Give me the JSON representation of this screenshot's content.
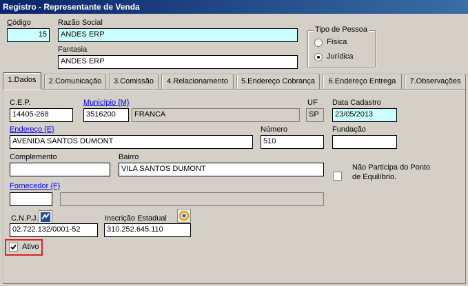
{
  "window": {
    "title": "Registro - Representante de Venda"
  },
  "header": {
    "codigo_label": "Código",
    "codigo_value": "15",
    "razao_label": "Razão Social",
    "razao_value": "ANDES ERP",
    "fantasia_label": "Fantasia",
    "fantasia_value": "ANDES ERP",
    "tipo_pessoa": {
      "title": "Tipo de Pessoa",
      "options": [
        {
          "label": "Física",
          "selected": false
        },
        {
          "label": "Jurídica",
          "selected": true
        }
      ]
    }
  },
  "tabs": [
    {
      "key": "1",
      "label": "1.Dados",
      "active": true
    },
    {
      "key": "2",
      "label": "2.Comunicação"
    },
    {
      "key": "3",
      "label": "3.Comissão"
    },
    {
      "key": "4",
      "label": "4.Relacionamento"
    },
    {
      "key": "5",
      "label": "5.Endereço Cobrança"
    },
    {
      "key": "6",
      "label": "6.Endereço Entrega"
    },
    {
      "key": "7",
      "label": "7.Observações"
    }
  ],
  "dados": {
    "cep_label": "C.E.P.",
    "cep_value": "14405-268",
    "municipio_label": "Município {M}",
    "municipio_code": "3516200",
    "municipio_name": "FRANCA",
    "uf_label": "UF",
    "uf_value": "SP",
    "data_cadastro_label": "Data Cadastro",
    "data_cadastro_value": "23/05/2013",
    "endereco_label": "Endereço {E}",
    "endereco_value": "AVENIDA SANTOS DUMONT",
    "numero_label": "Número",
    "numero_value": "510",
    "fundacao_label": "Fundação",
    "fundacao_value": "",
    "complemento_label": "Complemento",
    "complemento_value": "",
    "bairro_label": "Bairro",
    "bairro_value": "VILA SANTOS DUMONT",
    "ponto_equilibrio_label_1": "Não Participa do Ponto",
    "ponto_equilibrio_label_2": "de Equilíbrio.",
    "fornecedor_label": "Fornecedor {F}",
    "fornecedor_code": "",
    "fornecedor_name": "",
    "cnpj_label": "C.N.P.J.",
    "cnpj_value": "02.722.132/0001-52",
    "ie_label": "Inscrição Estadual",
    "ie_value": "310.252.645.110",
    "ativo_label": "Ativo",
    "ativo_checked": true
  },
  "colors": {
    "highlight": "#e0202a",
    "cyan_field": "#ccffff",
    "title_bar": "#0a246a"
  }
}
